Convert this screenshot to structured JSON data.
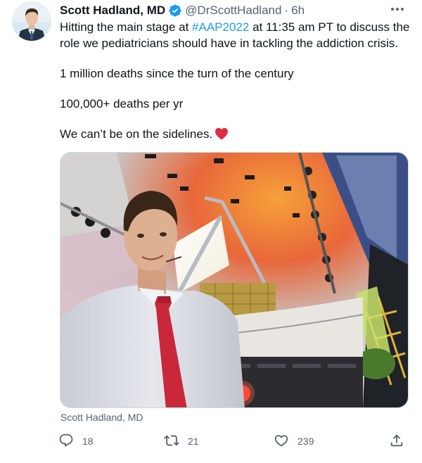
{
  "tweet": {
    "author": {
      "display_name": "Scott Hadland, MD",
      "handle": "@DrScottHadland",
      "separator": "·",
      "timestamp": "6h",
      "verified": true
    },
    "text": {
      "line1_before": "Hitting the main stage at ",
      "hashtag": "#AAP2022",
      "line1_after": " at 11:35 am PT to discuss the role we pediatricians should have in tackling the addiction crisis.",
      "para2": "1 million deaths since the turn of the century",
      "para3": "100,000+ deaths per yr",
      "para4": "We can’t be on the sidelines."
    },
    "media_caption": "Scott Hadland, MD",
    "actions": {
      "replies": "18",
      "retweets": "21",
      "likes": "239"
    },
    "icons": {
      "verified": "verified-badge-icon",
      "more": "more-options-icon",
      "reply": "reply-icon",
      "retweet": "retweet-icon",
      "like": "heart-icon",
      "share": "share-icon"
    },
    "colors": {
      "accent": "#1d9bf0",
      "muted": "#536471",
      "heart": "#e0245e"
    }
  }
}
